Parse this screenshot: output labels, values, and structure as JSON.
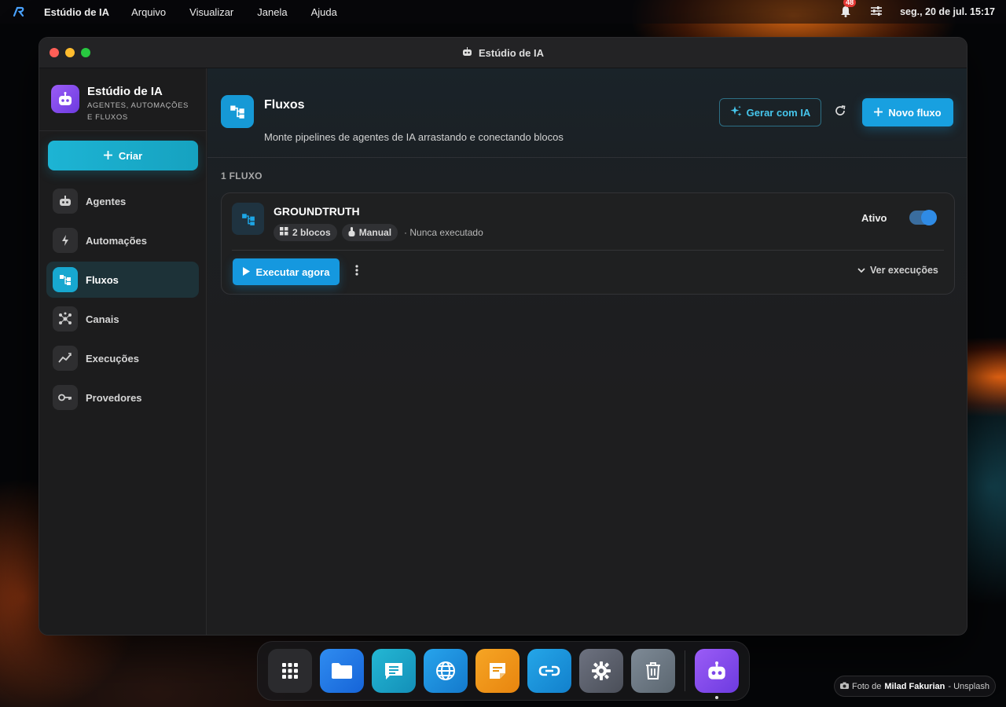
{
  "menubar": {
    "app_name": "Estúdio de IA",
    "menus": [
      "Arquivo",
      "Visualizar",
      "Janela",
      "Ajuda"
    ],
    "notification_count": "48",
    "clock": "seg., 20 de jul. 15:17"
  },
  "window": {
    "title": "Estúdio de IA"
  },
  "sidebar": {
    "brand_name": "Estúdio de IA",
    "brand_subtitle": "AGENTES, AUTOMAÇÕES E FLUXOS",
    "create_label": "Criar",
    "items": [
      {
        "label": "Agentes",
        "icon": "robot-icon"
      },
      {
        "label": "Automações",
        "icon": "bolt-icon"
      },
      {
        "label": "Fluxos",
        "icon": "flow-icon",
        "active": true
      },
      {
        "label": "Canais",
        "icon": "hub-icon"
      },
      {
        "label": "Execuções",
        "icon": "chart-icon"
      },
      {
        "label": "Provedores",
        "icon": "key-icon"
      }
    ]
  },
  "main": {
    "title": "Fluxos",
    "subtitle": "Monte pipelines de agentes de IA arrastando e conectando blocos",
    "generate_label": "Gerar com IA",
    "new_label": "Novo fluxo",
    "count_label": "1 FLUXO",
    "flows": [
      {
        "name": "GROUNDTRUTH",
        "blocks": "2 blocos",
        "trigger": "Manual",
        "last_run": "· Nunca executado",
        "status": "Ativo",
        "enabled": true,
        "run_label": "Executar agora",
        "runs_label": "Ver execuções"
      }
    ]
  },
  "dock": {
    "items": [
      "apps-icon",
      "folder-icon",
      "chat-icon",
      "globe-icon",
      "notes-icon",
      "link-icon",
      "settings-icon",
      "trash-icon",
      "robot-icon"
    ]
  },
  "credit": {
    "prefix": "Foto de",
    "author": "Milad Fakurian",
    "source": "- Unsplash"
  },
  "colors": {
    "accent": "#18a0e0",
    "brand_purple": "#8b4ef0",
    "active_nav": "#17a8d0"
  }
}
